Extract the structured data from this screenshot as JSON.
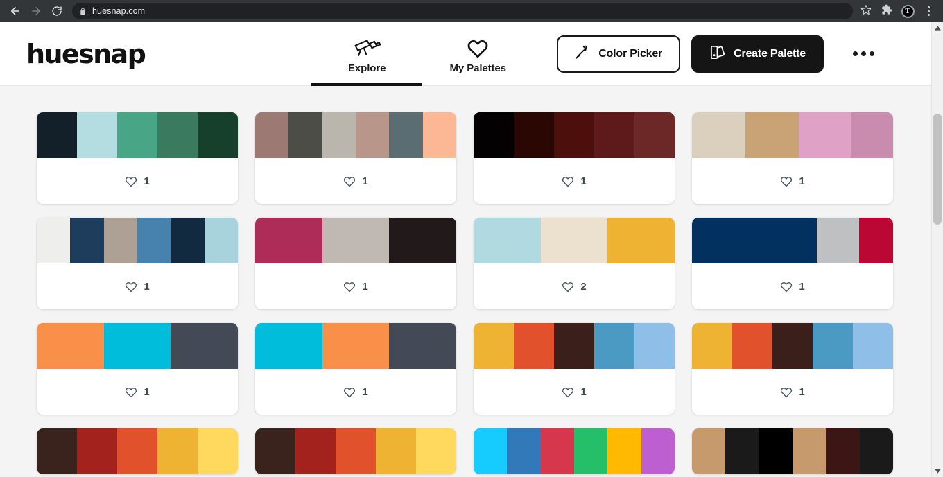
{
  "browser": {
    "back_icon": "arrow-left-icon",
    "forward_icon": "arrow-right-icon",
    "reload_icon": "reload-icon",
    "lock_icon": "lock-icon",
    "url": "huesnap.com",
    "bookmark_icon": "star-icon",
    "extensions_icon": "puzzle-piece-icon",
    "profile_initial": "T",
    "menu_icon": "kebab-menu-icon"
  },
  "header": {
    "logo": "huesnap",
    "tabs": [
      {
        "label": "Explore",
        "icon": "telescope-icon",
        "active": true
      },
      {
        "label": "My Palettes",
        "icon": "heart-icon",
        "active": false
      }
    ],
    "color_picker_label": "Color Picker",
    "color_picker_icon": "eyedropper-icon",
    "create_palette_label": "Create Palette",
    "create_palette_icon": "palette-swatch-icon",
    "more_icon": "ellipsis-icon"
  },
  "colors": {
    "accent_dark": "#151515",
    "page_bg": "#f4f4f4",
    "card_bg": "#ffffff",
    "like_text": "#3d4852"
  },
  "palettes": [
    {
      "likes": "1",
      "swatches": [
        "#142029",
        "#b3dde0",
        "#48a686",
        "#3a7a5e",
        "#17402c"
      ]
    },
    {
      "likes": "1",
      "swatches": [
        "#9d7974",
        "#4d4d47",
        "#bab5ad",
        "#b8978a",
        "#5a6d72",
        "#fcb795"
      ]
    },
    {
      "likes": "1",
      "swatches": [
        "#030102",
        "#2b0704",
        "#4d0f0c",
        "#5e1a1a",
        "#6b2827"
      ]
    },
    {
      "likes": "1",
      "swatches": [
        "#dbd0bd",
        "#c9a375",
        "#dfa1c6",
        "#ca8cae"
      ]
    },
    {
      "likes": "1",
      "swatches": [
        "#eeeeec",
        "#1e3d5c",
        "#ada195",
        "#4781ae",
        "#122a40",
        "#a8d3dc"
      ]
    },
    {
      "likes": "1",
      "swatches": [
        "#ad2c58",
        "#c0b8b2",
        "#221a1a"
      ]
    },
    {
      "likes": "2",
      "swatches": [
        "#b1d9e0",
        "#ece0cf",
        "#eeb332"
      ]
    },
    {
      "likes": "1",
      "swatches": [
        "#023160",
        "#bec0c2",
        "#bb0733"
      ]
    },
    {
      "likes": "1",
      "swatches": [
        "#f89049",
        "#00bedb",
        "#434a55"
      ]
    },
    {
      "likes": "1",
      "swatches": [
        "#00bedb",
        "#f89049",
        "#434a55"
      ]
    },
    {
      "likes": "1",
      "swatches": [
        "#eeb332",
        "#e1512c",
        "#3a1f1b",
        "#4b9ac4",
        "#8fbfe8"
      ]
    },
    {
      "likes": "1",
      "swatches": [
        "#eeb332",
        "#e1512c",
        "#3a1f1b",
        "#4b9ac4",
        "#8fbfe8"
      ]
    },
    {
      "likes": "",
      "swatches": [
        "#3a231d",
        "#a4221d",
        "#e1512c",
        "#eeb332",
        "#ffd95e"
      ]
    },
    {
      "likes": "",
      "swatches": [
        "#3a231d",
        "#a4221d",
        "#e1512c",
        "#eeb332",
        "#ffd95e"
      ]
    },
    {
      "likes": "",
      "swatches": [
        "#16ccfe",
        "#3179b8",
        "#d6374d",
        "#26bf69",
        "#ffba00",
        "#bd5fd1"
      ]
    },
    {
      "likes": "",
      "swatches": [
        "#c69a6c",
        "#1a1a1a",
        "#000000",
        "#c69a6c",
        "#3c1515",
        "#1a1a1a"
      ]
    }
  ]
}
